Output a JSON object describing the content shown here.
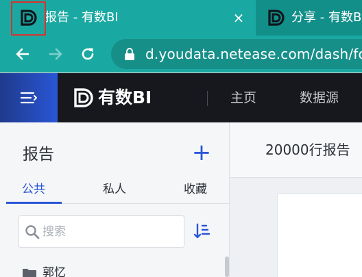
{
  "browser": {
    "tabs": [
      {
        "title": "报告 - 有数BI",
        "active": true,
        "close_glyph": "×"
      },
      {
        "title": "分享 - 有数BI",
        "active": false
      }
    ],
    "address": {
      "url": "d.youdata.netease.com/dash/fo"
    },
    "icons": {
      "favicon": "youdata-logo-icon",
      "back": "arrow-left-icon",
      "forward": "arrow-right-icon",
      "reload": "reload-icon",
      "lock": "lock-icon"
    },
    "colors": {
      "tab_active": "#1aa9a2",
      "tab_strip": "#138f8a",
      "highlight": "#d9322d"
    }
  },
  "app": {
    "brand": "有数BI",
    "nav": {
      "home": "主页",
      "datasource": "数据源"
    },
    "colors": {
      "accent": "#2a56d6",
      "header": "#16181d"
    }
  },
  "sidebar": {
    "title": "报告",
    "add_glyph": "+",
    "tabs": [
      "公共",
      "私人",
      "收藏"
    ],
    "active_tab": "公共",
    "search": {
      "placeholder": "搜索",
      "value": ""
    },
    "folders": [
      {
        "name": "郭忆"
      }
    ]
  },
  "main": {
    "report_title": "20000行报告"
  }
}
